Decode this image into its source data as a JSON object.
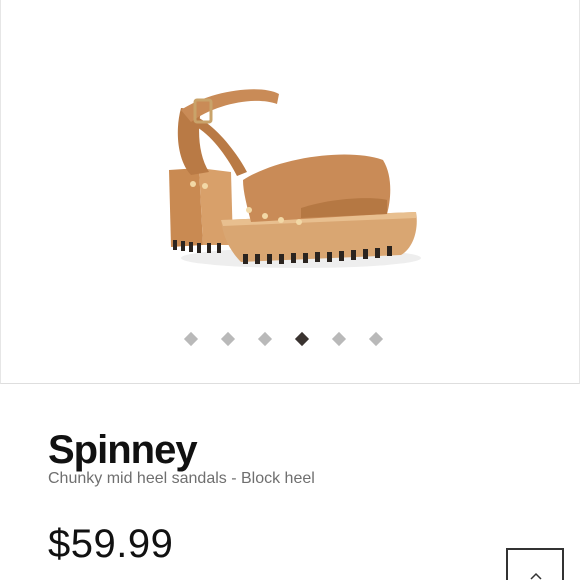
{
  "gallery": {
    "image_name": "tan-block-heel-sandal",
    "dots": [
      {
        "active": false
      },
      {
        "active": false
      },
      {
        "active": false
      },
      {
        "active": true
      },
      {
        "active": false
      },
      {
        "active": false
      }
    ]
  },
  "product": {
    "name": "Spinney",
    "description": "Chunky mid heel sandals - Block heel",
    "price": "$59.99"
  },
  "colors": {
    "leather": "#c98b57",
    "sole": "#d8a470",
    "active_dot": "#3a3330",
    "inactive_dot": "#b9b9b9"
  },
  "icons": {
    "scroll_top": "chevron-up-icon"
  }
}
